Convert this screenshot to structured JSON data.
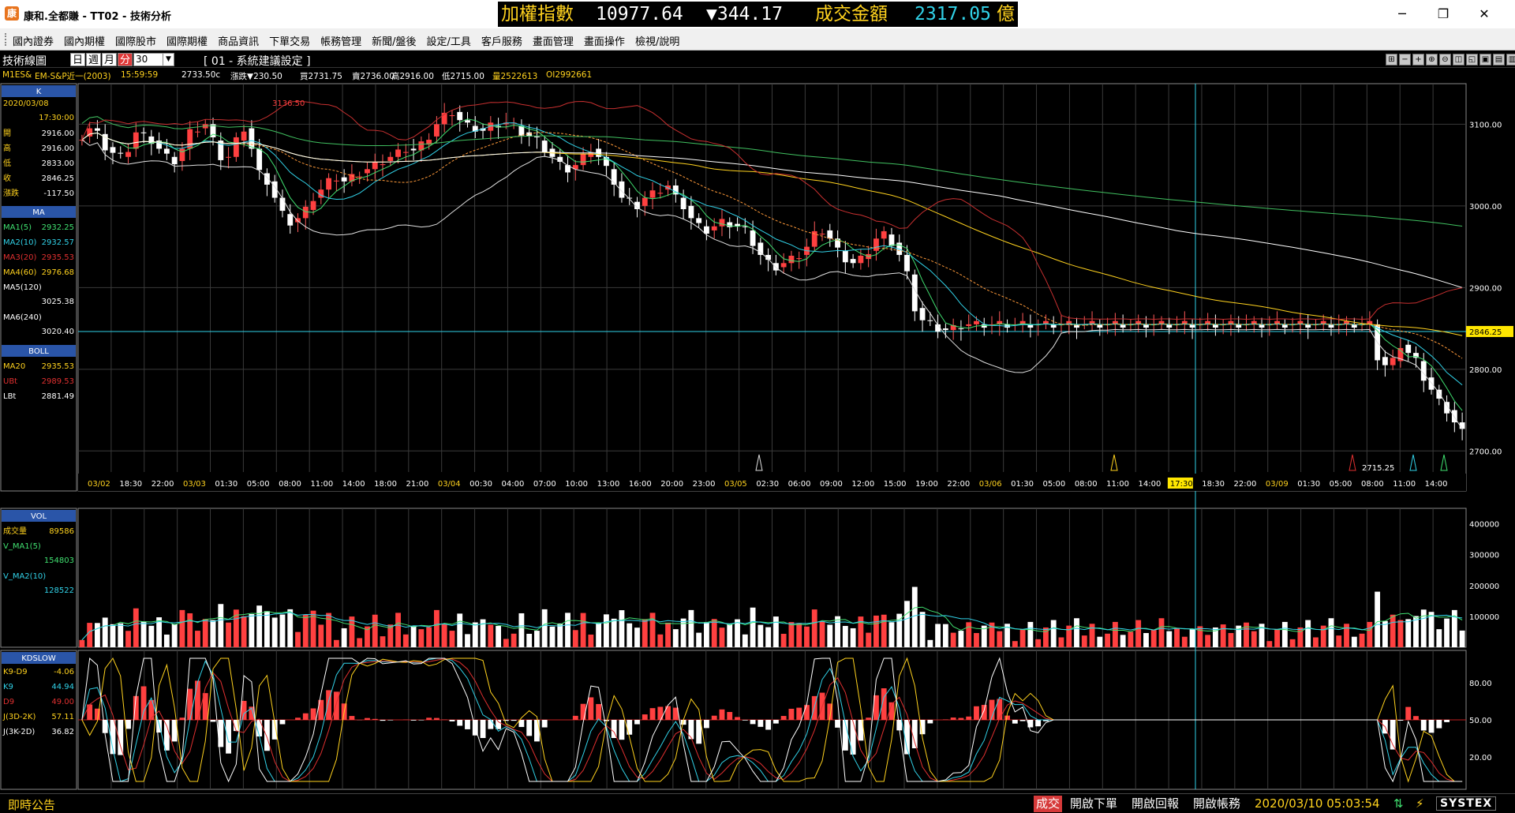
{
  "window": {
    "title": "康和.全都賺 - TT02 - 技術分析",
    "app_icon": "康",
    "controls": {
      "minimize": "─",
      "restore": "❐",
      "close": "✕"
    }
  },
  "ticker": {
    "name": "加權指數",
    "value": "10977.64",
    "change": "▼344.17",
    "amount_label": "成交金額",
    "amount": "2317.05",
    "unit": "億",
    "colors": {
      "name": "#ffd21e",
      "value": "#ffffff",
      "change": "#ffffff",
      "amount_label": "#ffd21e",
      "amount": "#31d2e8",
      "unit": "#ffd21e"
    }
  },
  "menu": [
    "國內證券",
    "國內期權",
    "國際股市",
    "國際期權",
    "商品資訊",
    "下單交易",
    "帳務管理",
    "新聞/盤後",
    "設定/工具",
    "客戶服務",
    "畫面管理",
    "畫面操作",
    "檢視/說明"
  ],
  "toolbar": {
    "title": "技術線圖",
    "periods": [
      "日",
      "週",
      "月",
      "分"
    ],
    "active_period": "分",
    "interval": "30",
    "setting": "[ 01 - 系統建議設定 ]",
    "tools": [
      "⊞",
      "−",
      "+",
      "⊕",
      "⊖",
      "◫",
      "◱",
      "▣",
      "▤",
      "▥"
    ]
  },
  "quote": {
    "symbol": "M1ES&",
    "name": "EM-S&P近一(2003)",
    "time": "15:59:59",
    "price": "2733.50c",
    "change": "漲跌▼230.50",
    "bid": "買2731.75",
    "ask": "賣2736.00",
    "high": "高2916.00",
    "low": "低2715.00",
    "volume": "量2522613",
    "oi": "OI2992661"
  },
  "panels": {
    "k": {
      "header": "K",
      "date": "2020/03/08",
      "time": "17:30:00",
      "rows": [
        {
          "label": "開",
          "value": "2916.00"
        },
        {
          "label": "高",
          "value": "2916.00"
        },
        {
          "label": "低",
          "value": "2833.00"
        },
        {
          "label": "收",
          "value": "2846.25"
        },
        {
          "label": "漲跌",
          "value": "-117.50"
        }
      ]
    },
    "ma": {
      "header": "MA",
      "rows": [
        {
          "label": "MA1(5)",
          "value": "2932.25",
          "color": "#40e070"
        },
        {
          "label": "MA2(10)",
          "value": "2932.57",
          "color": "#31d2e8"
        },
        {
          "label": "MA3(20)",
          "value": "2935.53",
          "color": "#e03030"
        },
        {
          "label": "MA4(60)",
          "value": "2976.68",
          "color": "#ffd21e"
        },
        {
          "label": "MA5(120)",
          "value": "3025.38",
          "color": "#ffffff"
        },
        {
          "label": "MA6(240)",
          "value": "3020.40",
          "color": "#ffffff"
        }
      ]
    },
    "boll": {
      "header": "BOLL",
      "rows": [
        {
          "label": "MA20",
          "value": "2935.53",
          "color": "#ffd21e"
        },
        {
          "label": "UBt",
          "value": "2989.53",
          "color": "#e03030"
        },
        {
          "label": "LBt",
          "value": "2881.49",
          "color": "#ffffff"
        }
      ]
    },
    "vol": {
      "header": "VOL",
      "rows": [
        {
          "label": "成交量",
          "value": "89586",
          "color": "#ffd21e"
        },
        {
          "label": "V_MA1(5)",
          "value": "154803",
          "color": "#40e070"
        },
        {
          "label": "V_MA2(10)",
          "value": "128522",
          "color": "#31d2e8"
        }
      ],
      "ticks": [
        "400000",
        "300000",
        "200000",
        "100000"
      ]
    },
    "kd": {
      "header": "KDSLOW",
      "rows": [
        {
          "label": "K9-D9",
          "value": "-4.06",
          "color": "#ffd21e"
        },
        {
          "label": "K9",
          "value": "44.94",
          "color": "#31d2e8"
        },
        {
          "label": "D9",
          "value": "49.00",
          "color": "#e03030"
        },
        {
          "label": "J(3D-2K)",
          "value": "57.11",
          "color": "#ffd21e"
        },
        {
          "label": "J(3K-2D)",
          "value": "36.82",
          "color": "#ffffff"
        }
      ],
      "ticks": [
        "80.00",
        "50.00",
        "20.00"
      ]
    }
  },
  "price_axis": {
    "ticks": [
      "3100.00",
      "3000.00",
      "2900.00",
      "2800.00",
      "2700.00"
    ],
    "current_label": "2846.25",
    "high_label": "3136.50",
    "low_label": "2715.25"
  },
  "time_axis": [
    {
      "t": "03/02",
      "c": "#ffd21e"
    },
    {
      "t": "18:30"
    },
    {
      "t": "22:00"
    },
    {
      "t": "03/03",
      "c": "#ffd21e"
    },
    {
      "t": "01:30"
    },
    {
      "t": "05:00"
    },
    {
      "t": "08:00"
    },
    {
      "t": "11:00"
    },
    {
      "t": "14:00"
    },
    {
      "t": "18:00"
    },
    {
      "t": "21:00"
    },
    {
      "t": "03/04",
      "c": "#ffd21e"
    },
    {
      "t": "00:30"
    },
    {
      "t": "04:00"
    },
    {
      "t": "07:00"
    },
    {
      "t": "10:00"
    },
    {
      "t": "13:00"
    },
    {
      "t": "16:00"
    },
    {
      "t": "20:00"
    },
    {
      "t": "23:00"
    },
    {
      "t": "03/05",
      "c": "#ffd21e"
    },
    {
      "t": "02:30"
    },
    {
      "t": "06:00"
    },
    {
      "t": "09:00"
    },
    {
      "t": "12:00"
    },
    {
      "t": "15:00"
    },
    {
      "t": "19:00"
    },
    {
      "t": "22:00"
    },
    {
      "t": "03/06",
      "c": "#ffd21e"
    },
    {
      "t": "01:30"
    },
    {
      "t": "05:00"
    },
    {
      "t": "08:00"
    },
    {
      "t": "11:00"
    },
    {
      "t": "14:00"
    },
    {
      "t": "17:30",
      "hl": true
    },
    {
      "t": "18:30"
    },
    {
      "t": "22:00"
    },
    {
      "t": "03/09",
      "c": "#ffd21e"
    },
    {
      "t": "01:30"
    },
    {
      "t": "05:00"
    },
    {
      "t": "08:00"
    },
    {
      "t": "11:00"
    },
    {
      "t": "14:00"
    }
  ],
  "status": {
    "left": "即時公告",
    "trade": "成交",
    "buttons": [
      "開啟下單",
      "開啟回報",
      "開啟帳務"
    ],
    "time": "2020/03/10 05:03:54",
    "brand": "SYSTEX"
  },
  "chart_data": {
    "type": "candlestick",
    "x_range": [
      "03/02 17:00",
      "03/09 15:30"
    ],
    "price_range": [
      2680,
      3140
    ],
    "price": {
      "open": [
        3080,
        3085,
        3095,
        3088,
        3072,
        3065,
        3060,
        3070,
        3090,
        3085,
        3080,
        3070,
        3060,
        3055,
        3070,
        3090,
        3095,
        3100,
        3080,
        3060,
        3060,
        3080,
        3095,
        3070,
        3040,
        3030,
        3010,
        2990,
        2980,
        2985,
        2995,
        3010,
        3020,
        3030,
        3035,
        3030,
        3035,
        3040,
        3045,
        3050,
        3055,
        3060,
        3065,
        3070,
        3068,
        3075,
        3085,
        3100,
        3110,
        3115,
        3105,
        3098,
        3095,
        3092,
        3098,
        3100,
        3102,
        3098,
        3090,
        3085,
        3080,
        3070,
        3060,
        3050,
        3045,
        3050,
        3060,
        3070,
        3060,
        3045,
        3030,
        3010,
        3005,
        3000,
        3010,
        3015,
        3020,
        3025,
        3010,
        3000,
        2985,
        2975,
        2970,
        2975,
        2980,
        2978,
        2975,
        2970,
        2955,
        2940,
        2930,
        2925,
        2930,
        2935,
        2940,
        2950,
        2965,
        2970,
        2960,
        2945,
        2935,
        2930,
        2935,
        2945,
        2960,
        2965,
        2955,
        2940,
        2916,
        2875,
        2860,
        2855,
        2850,
        2848,
        2850,
        2853,
        2855,
        2855,
        2855,
        2855,
        2855,
        2855,
        2855,
        2855,
        2855,
        2855,
        2855,
        2855,
        2855,
        2855,
        2855,
        2855,
        2855,
        2855,
        2855,
        2855,
        2855,
        2855,
        2855,
        2855,
        2855,
        2855,
        2855,
        2855,
        2855,
        2855,
        2855,
        2855,
        2855,
        2855,
        2855,
        2855,
        2855,
        2855,
        2855,
        2855,
        2855,
        2855,
        2855,
        2855,
        2855,
        2855,
        2855,
        2855,
        2855,
        2855,
        2855,
        2855,
        2855,
        2815,
        2805,
        2810,
        2830,
        2820,
        2810,
        2790,
        2775,
        2760,
        2750,
        2735
      ],
      "note": "open series only, as recreated from the candles"
    },
    "volume_ticks": [
      100000,
      200000,
      300000,
      400000
    ],
    "kd_ticks": [
      20,
      50,
      80
    ]
  }
}
